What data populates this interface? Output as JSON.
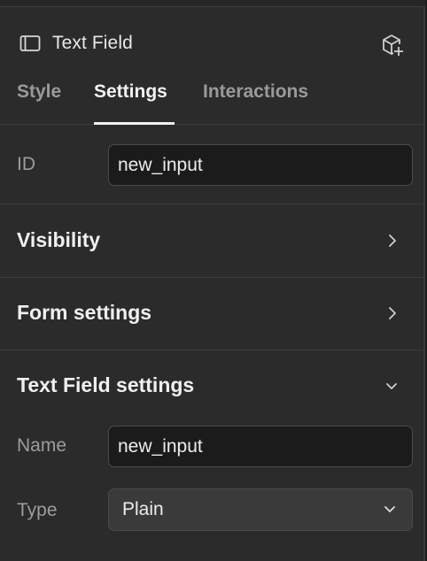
{
  "header": {
    "title": "Text Field",
    "element_icon": "textfield-icon",
    "action_icon": "add-component-icon"
  },
  "tabs": [
    {
      "label": "Style",
      "active": false
    },
    {
      "label": "Settings",
      "active": true
    },
    {
      "label": "Interactions",
      "active": false
    }
  ],
  "id_field": {
    "label": "ID",
    "value": "new_input"
  },
  "sections": {
    "visibility": {
      "title": "Visibility",
      "icon": "chevron-right-icon"
    },
    "form_settings": {
      "title": "Form settings",
      "icon": "chevron-right-icon"
    },
    "text_field_settings": {
      "title": "Text Field settings",
      "icon": "chevron-down-icon"
    }
  },
  "name_field": {
    "label": "Name",
    "value": "new_input"
  },
  "type_field": {
    "label": "Type",
    "value": "Plain",
    "icon": "chevron-down-icon"
  },
  "colors": {
    "panel": "#2b2b2b",
    "input_bg": "#1b1b1b",
    "select_bg": "#3a3a3a",
    "active_tab": "#f2f2f2",
    "muted": "#9a9a9a"
  }
}
